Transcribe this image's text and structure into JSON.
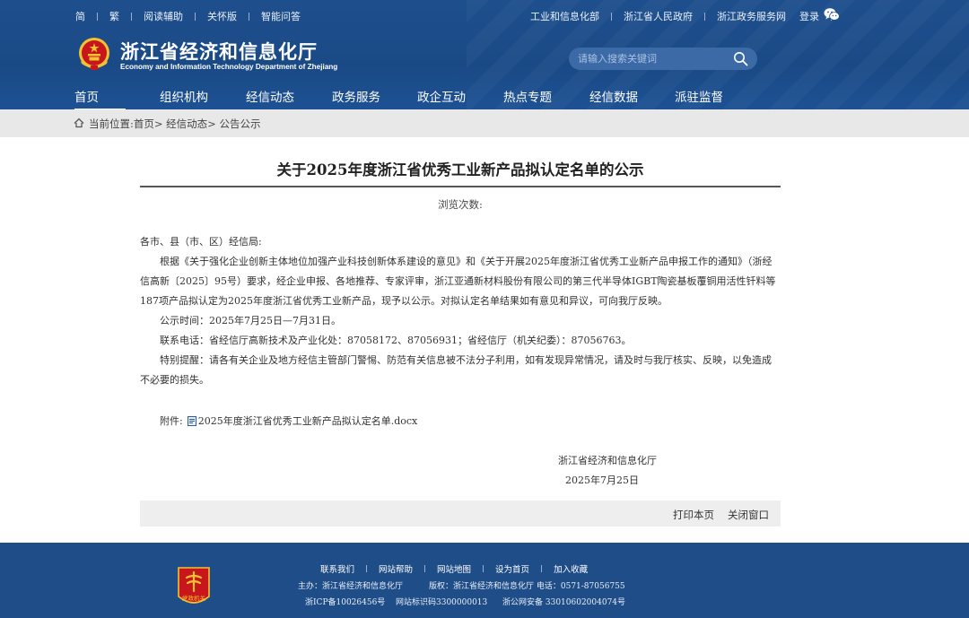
{
  "topbar": {
    "left_links": [
      "简",
      "繁",
      "阅读辅助",
      "关怀版",
      "智能问答"
    ],
    "right_links": [
      "工业和信息化部",
      "浙江省人民政府",
      "浙江政务服务网",
      "登录"
    ]
  },
  "site": {
    "name_cn": "浙江省经济和信息化厅",
    "name_en": "Economy and Information Technology Department of Zhejiang"
  },
  "search": {
    "placeholder": "请输入搜索关键词"
  },
  "nav": [
    "首页",
    "组织机构",
    "经信动态",
    "政务服务",
    "政企互动",
    "热点专题",
    "经信数据",
    "派驻监督"
  ],
  "breadcrumb": {
    "prefix": "当前位置:",
    "items": [
      "首页",
      "经信动态",
      "公告公示"
    ],
    "separator": ">"
  },
  "article": {
    "title": "关于2025年度浙江省优秀工业新产品拟认定名单的公示",
    "views_label": "浏览次数:",
    "salutation": "各市、县（市、区）经信局:",
    "body": "根据《关于强化企业创新主体地位加强产业科技创新体系建设的意见》和《关于开展2025年度浙江省优秀工业新产品申报工作的通知》（浙经信高新〔2025〕95号）要求，经企业申报、各地推荐、专家评审，浙江亚通新材料股份有限公司的第三代半导体IGBT陶瓷基板覆铜用活性钎料等187项产品拟认定为2025年度浙江省优秀工业新产品，现予以公示。对拟认定名单结果如有意见和异议，可向我厅反映。",
    "period": "公示时间：2025年7月25日—7月31日。",
    "contact": "联系电话：省经信厅高新技术及产业化处：87058172、87056931；省经信厅（机关纪委）：87056763。",
    "reminder": "特别提醒：请各有关企业及地方经信主管部门警惕、防范有关信息被不法分子利用，如有发现异常情况，请及时与我厅核实、反映，以免造成不必要的损失。",
    "attachment_label": "附件:",
    "attachment_file": "2025年度浙江省优秀工业新产品拟认定名单.docx",
    "signature_org": "浙江省经济和信息化厅",
    "signature_date": "2025年7月25日"
  },
  "actions": {
    "print": "打印本页",
    "close": "关闭窗口"
  },
  "footer": {
    "links": [
      "联系我们",
      "网站帮助",
      "网站地图",
      "设为首页",
      "加入收藏"
    ],
    "host": "主办：浙江省经济和信息化厅",
    "copyright": "版权：浙江省经济和信息化厅 电话：0571-87056755",
    "icp": "浙ICP备10026456号",
    "site_code": "网站标识码3300000013",
    "police": "浙公网安备 33010602004074号",
    "badge_text": "党政机关"
  },
  "colors": {
    "header_blue": "#1e4f8d",
    "footer_blue": "#1f4d87",
    "crumb_gray": "#e8e8e8",
    "emblem_red": "#c8161d",
    "emblem_gold": "#f2c230"
  }
}
